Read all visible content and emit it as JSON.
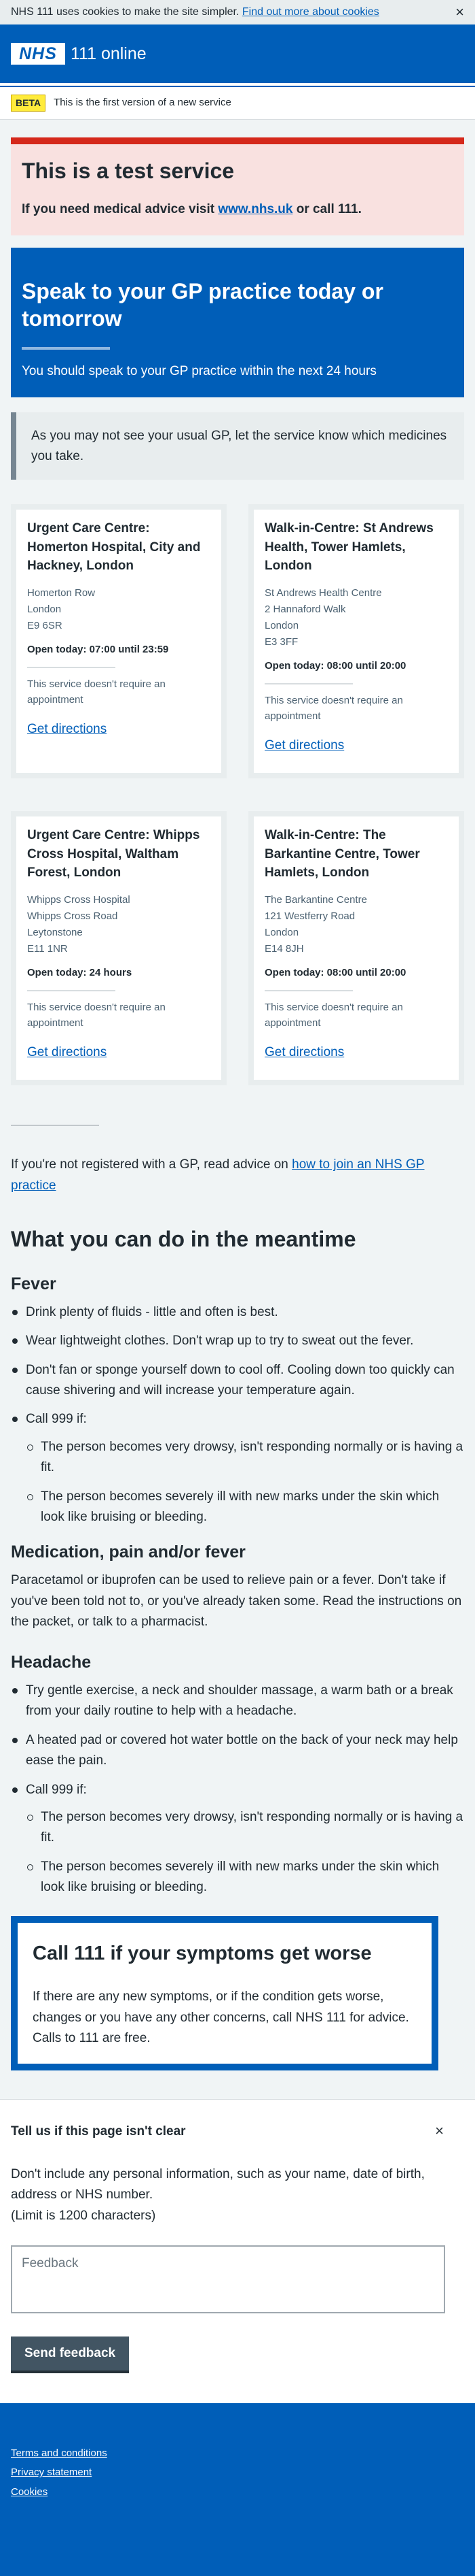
{
  "cookie_banner": {
    "text": "NHS 111 uses cookies to make the site simpler.",
    "link": "Find out more about cookies",
    "close": "×"
  },
  "header": {
    "logo": "NHS",
    "service_name": "111 online"
  },
  "beta": {
    "tag": "BETA",
    "text": "This is the first version of a new service"
  },
  "test_notice": {
    "title": "This is a test service",
    "text_before": "If you need medical advice visit",
    "link": "www.nhs.uk",
    "text_after": "or call 111."
  },
  "care_card": {
    "title": "Speak to your GP practice today or tomorrow",
    "text": "You should speak to your GP practice within the next 24 hours"
  },
  "inset": {
    "text": "As you may not see your usual GP, let the service know which medicines you take."
  },
  "services": [
    {
      "name": "Urgent Care Centre: Homerton Hospital, City and Hackney, London",
      "address": [
        "Homerton Row",
        "London",
        "E9 6SR"
      ],
      "opening": "Open today: 07:00 until 23:59",
      "note": "This service doesn't require an appointment",
      "directions": "Get directions"
    },
    {
      "name": "Walk-in-Centre: St Andrews Health, Tower Hamlets, London",
      "address": [
        "St Andrews Health Centre",
        "2 Hannaford Walk",
        "London",
        "E3 3FF"
      ],
      "opening": "Open today: 08:00 until 20:00",
      "note": "This service doesn't require an appointment",
      "directions": "Get directions"
    },
    {
      "name": "Urgent Care Centre: Whipps Cross Hospital, Waltham Forest, London",
      "address": [
        "Whipps Cross Hospital",
        "Whipps Cross Road",
        "Leytonstone",
        "E11 1NR"
      ],
      "opening": "Open today: 24 hours",
      "note": "This service doesn't require an appointment",
      "directions": "Get directions"
    },
    {
      "name": "Walk-in-Centre: The Barkantine Centre, Tower Hamlets, London",
      "address": [
        "The Barkantine Centre",
        "121 Westferry Road",
        "London",
        "E14 8JH"
      ],
      "opening": "Open today: 08:00 until 20:00",
      "note": "This service doesn't require an appointment",
      "directions": "Get directions"
    }
  ],
  "gp_register": {
    "text": "If you're not registered with a GP, read advice on",
    "link": "how to join an NHS GP practice"
  },
  "meantime": {
    "title": "What you can do in the meantime",
    "fever": {
      "heading": "Fever",
      "items": [
        "Drink plenty of fluids - little and often is best.",
        "Wear lightweight clothes. Don't wrap up to try to sweat out the fever.",
        "Don't fan or sponge yourself down to cool off. Cooling down too quickly can cause shivering and will increase your temperature again.",
        "Call 999 if:"
      ],
      "sub_items": [
        "The person becomes very drowsy, isn't responding normally or is having a fit.",
        "The person becomes severely ill with new marks under the skin which look like bruising or bleeding."
      ]
    },
    "medication": {
      "heading": "Medication, pain and/or fever",
      "text": "Paracetamol or ibuprofen can be used to relieve pain or a fever. Don't take if you've been told not to, or you've already taken some. Read the instructions on the packet, or talk to a pharmacist."
    },
    "headache": {
      "heading": "Headache",
      "items": [
        "Try gentle exercise, a neck and shoulder massage, a warm bath or a break from your daily routine to help with a headache.",
        "A heated pad or covered hot water bottle on the back of your neck may help ease the pain.",
        "Call 999 if:"
      ],
      "sub_items": [
        "The person becomes very drowsy, isn't responding normally or is having a fit.",
        "The person becomes severely ill with new marks under the skin which look like bruising or bleeding."
      ]
    }
  },
  "call_111": {
    "title": "Call 111 if your symptoms get worse",
    "text": "If there are any new symptoms, or if the condition gets worse, changes or you have any other concerns, call NHS 111 for advice. Calls to 111 are free."
  },
  "feedback": {
    "title": "Tell us if this page isn't clear",
    "close": "×",
    "text": "Don't include any personal information, such as your name, date of birth, address or NHS number.",
    "limit": "(Limit is 1200 characters)",
    "placeholder": "Feedback",
    "button": "Send feedback"
  },
  "footer": {
    "links": [
      "Terms and conditions",
      "Privacy statement",
      "Cookies"
    ]
  }
}
